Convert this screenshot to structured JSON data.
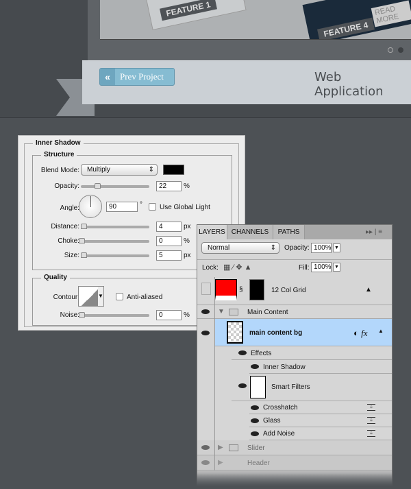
{
  "preview": {
    "feature1": "FEATURE 1",
    "feature4": "FEATURE 4",
    "read_more": "READ MORE",
    "prev_button": "Prev Project",
    "prev_icon": "double-chevron-left",
    "title": "Web Application"
  },
  "dialog": {
    "title": "Inner Shadow",
    "structure": "Structure",
    "blend_label": "Blend Mode:",
    "blend_value": "Multiply",
    "shadow_color": "#000000",
    "opacity_label": "Opacity:",
    "opacity": "22",
    "opacity_unit": "%",
    "angle_label": "Angle:",
    "angle": "90",
    "angle_unit": "°",
    "global_light": "Use Global Light",
    "distance_label": "Distance:",
    "distance": "4",
    "distance_unit": "px",
    "choke_label": "Choke:",
    "choke": "0",
    "choke_unit": "%",
    "size_label": "Size:",
    "size": "5",
    "size_unit": "px",
    "quality": "Quality",
    "contour_label": "Contour:",
    "anti_aliased": "Anti-aliased",
    "noise_label": "Noise:",
    "noise": "0",
    "noise_unit": "%"
  },
  "layers": {
    "tabs": [
      "LAYERS",
      "CHANNELS",
      "PATHS"
    ],
    "blend": "Normal",
    "opacity_label": "Opacity:",
    "opacity": "100%",
    "lock_label": "Lock:",
    "fill_label": "Fill:",
    "fill": "100%",
    "items": {
      "grid": "12 Col Grid",
      "main": "Main Content",
      "bg": "main content bg",
      "effects": "Effects",
      "inner": "Inner Shadow",
      "smart": "Smart Filters",
      "cross": "Crosshatch",
      "glass": "Glass",
      "noise": "Add Noise",
      "slider": "Slider",
      "header": "Header"
    }
  }
}
